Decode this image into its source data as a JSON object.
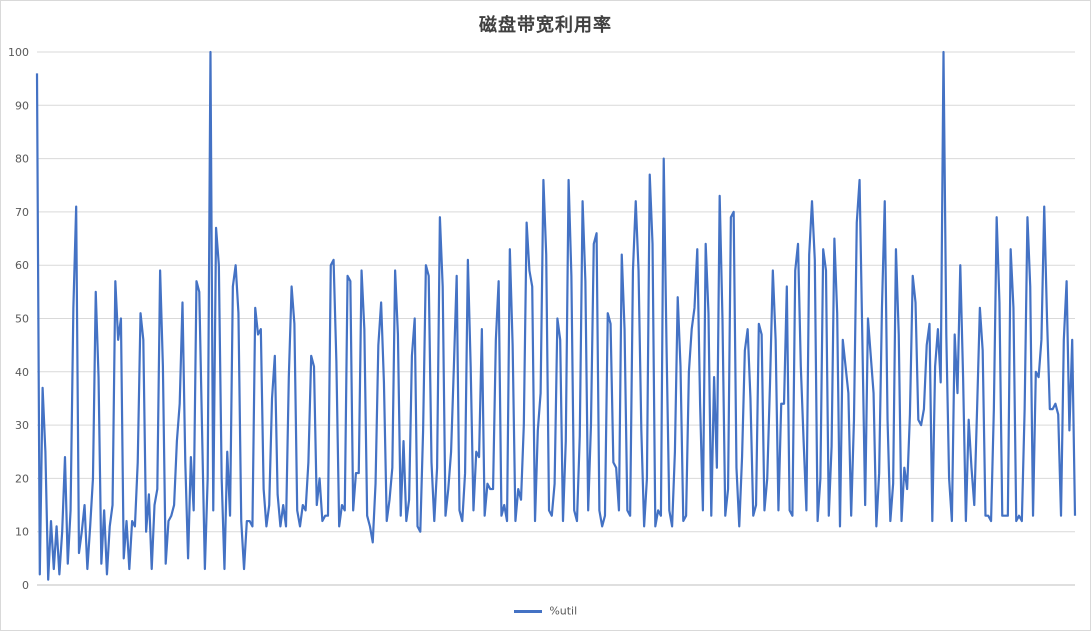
{
  "chart_data": {
    "type": "line",
    "title": "磁盘带宽利用率",
    "xlabel": "",
    "ylabel": "",
    "ylim": [
      0,
      100
    ],
    "yticks": [
      0,
      10,
      20,
      30,
      40,
      50,
      60,
      70,
      80,
      90,
      100
    ],
    "grid": true,
    "legend_position": "bottom",
    "colors": {
      "series": "#4472c4",
      "grid": "#d9d9d9",
      "axis": "#bfbfbf"
    },
    "note_values": "x is the sample index (no x tick labels are shown); values estimated from gridlines at the visible spikes. Between spikes the series oscillates densely between about 0 and 13.",
    "series": [
      {
        "name": "%util",
        "values": [
          96,
          2,
          37,
          25,
          1,
          12,
          3,
          11,
          2,
          10,
          24,
          4,
          14,
          52,
          71,
          6,
          10,
          15,
          3,
          11,
          20,
          55,
          39,
          4,
          14,
          2,
          11,
          15,
          57,
          46,
          50,
          5,
          12,
          3,
          12,
          11,
          23,
          51,
          46,
          10,
          17,
          3,
          15,
          18,
          59,
          41,
          4,
          12,
          13,
          15,
          27,
          34,
          53,
          23,
          5,
          24,
          14,
          57,
          55,
          29,
          3,
          20,
          100,
          14,
          67,
          60,
          20,
          3,
          25,
          13,
          56,
          60,
          51,
          12,
          3,
          12,
          12,
          11,
          52,
          47,
          48,
          18,
          11,
          15,
          35,
          43,
          17,
          11,
          15,
          11,
          39,
          56,
          49,
          14,
          11,
          15,
          14,
          23,
          43,
          41,
          15,
          20,
          12,
          13,
          13,
          60,
          61,
          42,
          11,
          15,
          14,
          58,
          57,
          14,
          21,
          21,
          59,
          48,
          13,
          11,
          8,
          19,
          45,
          53,
          38,
          12,
          16,
          22,
          59,
          47,
          13,
          27,
          12,
          16,
          43,
          50,
          11,
          10,
          29,
          60,
          58,
          23,
          12,
          22,
          69,
          56,
          13,
          18,
          25,
          41,
          58,
          14,
          12,
          21,
          61,
          41,
          14,
          25,
          24,
          48,
          13,
          19,
          18,
          18,
          46,
          57,
          13,
          15,
          12,
          63,
          45,
          12,
          18,
          16,
          30,
          68,
          59,
          56,
          12,
          29,
          36,
          76,
          62,
          14,
          13,
          19,
          50,
          46,
          12,
          27,
          76,
          58,
          14,
          12,
          28,
          72,
          57,
          14,
          30,
          64,
          66,
          14,
          11,
          13,
          51,
          49,
          23,
          22,
          14,
          62,
          48,
          14,
          13,
          59,
          72,
          59,
          29,
          11,
          20,
          77,
          64,
          11,
          14,
          13,
          80,
          45,
          14,
          11,
          25,
          54,
          41,
          12,
          13,
          40,
          48,
          52,
          63,
          34,
          14,
          64,
          51,
          13,
          39,
          22,
          73,
          50,
          13,
          18,
          69,
          70,
          22,
          11,
          24,
          44,
          48,
          35,
          13,
          15,
          49,
          47,
          14,
          20,
          38,
          59,
          46,
          14,
          34,
          34,
          56,
          14,
          13,
          59,
          64,
          41,
          27,
          14,
          62,
          72,
          61,
          12,
          20,
          63,
          59,
          13,
          26,
          65,
          51,
          11,
          46,
          41,
          36,
          13,
          31,
          68,
          76,
          46,
          15,
          50,
          43,
          36,
          11,
          21,
          52,
          72,
          31,
          12,
          19,
          63,
          47,
          12,
          22,
          18,
          32,
          58,
          53,
          31,
          30,
          33,
          45,
          49,
          12,
          41,
          48,
          38,
          100,
          47,
          20,
          12,
          47,
          36,
          60,
          39,
          12,
          31,
          22,
          15,
          33,
          52,
          44,
          13,
          13,
          12,
          33,
          69,
          53,
          13,
          13,
          13,
          63,
          52,
          12,
          13,
          12,
          33,
          69,
          56,
          13,
          40,
          39,
          46,
          71,
          50,
          33,
          33,
          34,
          32,
          13,
          46,
          57,
          29,
          46,
          13
        ]
      }
    ]
  }
}
